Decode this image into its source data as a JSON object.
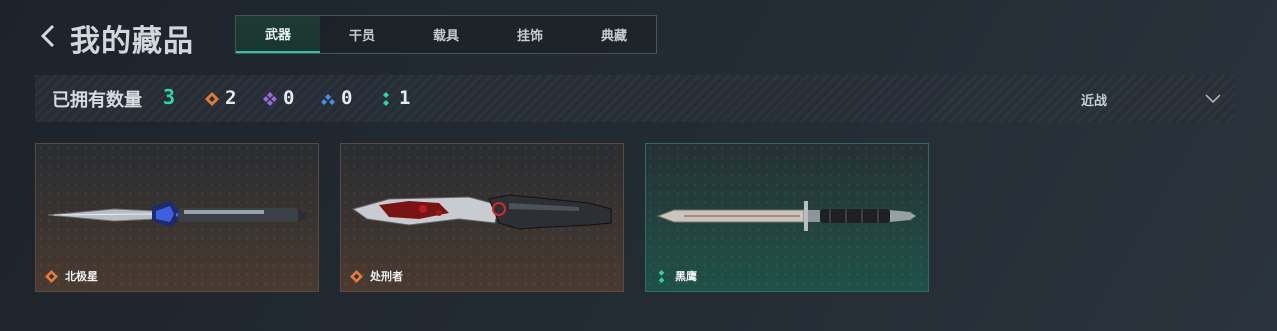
{
  "header": {
    "title": "我的藏品",
    "back_icon": "chevron-left-icon"
  },
  "tabs": [
    {
      "label": "武器",
      "active": true
    },
    {
      "label": "干员",
      "active": false
    },
    {
      "label": "载具",
      "active": false
    },
    {
      "label": "挂饰",
      "active": false
    },
    {
      "label": "典藏",
      "active": false
    }
  ],
  "stats": {
    "owned_label": "已拥有数量",
    "owned_count": "3",
    "rarity": [
      {
        "icon": "orange-diamond-icon",
        "color": "#e07a3a",
        "count": "2"
      },
      {
        "icon": "purple-diamond-icon",
        "color": "#9a6be0",
        "count": "0"
      },
      {
        "icon": "blue-diamond-icon",
        "color": "#4a8fe0",
        "count": "0"
      },
      {
        "icon": "green-diamond-icon",
        "color": "#2fd6a0",
        "count": "1"
      }
    ]
  },
  "filter": {
    "label": "近战",
    "icon": "chevron-down-icon"
  },
  "items": [
    {
      "name": "北极星",
      "rarity": "orange",
      "rarity_color": "#e07a3a",
      "style": "brown"
    },
    {
      "name": "处刑者",
      "rarity": "orange",
      "rarity_color": "#e07a3a",
      "style": "brown"
    },
    {
      "name": "黑鹰",
      "rarity": "green",
      "rarity_color": "#2fd6a0",
      "style": "teal"
    }
  ],
  "colors": {
    "accent": "#2fd6a0",
    "background": "#1f262e"
  }
}
